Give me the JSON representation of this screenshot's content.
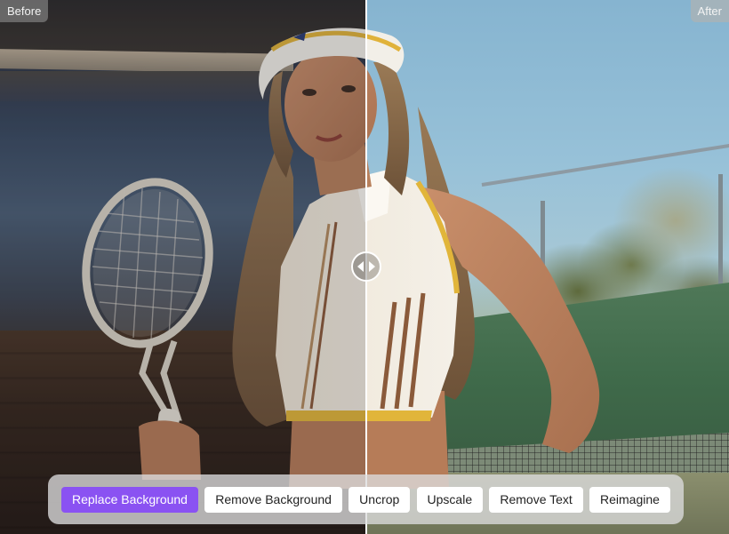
{
  "comparison": {
    "before_label": "Before",
    "after_label": "After",
    "divider_icon": "left-right-arrows-icon"
  },
  "toolbar": {
    "active_index": 0,
    "accent_color": "#8a52f2",
    "buttons": [
      {
        "label": "Replace Background"
      },
      {
        "label": "Remove Background"
      },
      {
        "label": "Uncrop"
      },
      {
        "label": "Upscale"
      },
      {
        "label": "Remove Text"
      },
      {
        "label": "Reimagine"
      }
    ]
  }
}
